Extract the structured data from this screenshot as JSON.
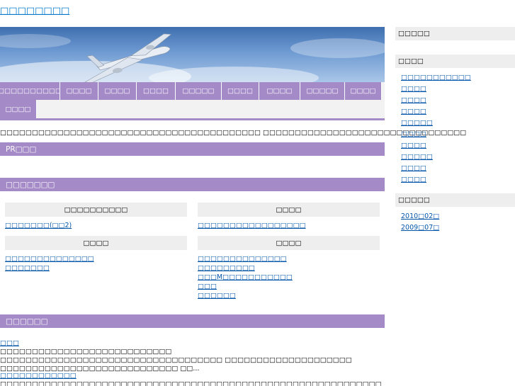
{
  "site": {
    "title": "□□□□□□□□"
  },
  "hero": {
    "image_icon": "airplane-icon"
  },
  "nav": {
    "row1": [
      "□□□□□□□□□□",
      "□□□□",
      "□□□□",
      "□□□□",
      "□□□□□",
      "□□□□",
      "□□□□",
      "□□□□□",
      "□□□□"
    ],
    "row2": [
      "□□□□"
    ]
  },
  "intro": {
    "text": "□□□□□□□□□□□□□□□□□□□□□□□□□□□□□□□□□□□□□□□□□ □□□□□□□□□□□□□□□□□□□□□□□□□□□□□□□□"
  },
  "sections": {
    "pr": "PR□□□",
    "categories": "□□□□□□□",
    "recent": "□□□□□□"
  },
  "categories": [
    {
      "title": "□□□□□□□□□□",
      "links": [
        "□□□□□□□(□□2)"
      ]
    },
    {
      "title": "□□□□",
      "links": [
        "□□□□□□□□□□□□□□□□□"
      ]
    },
    {
      "title": "□□□□",
      "links": [
        "□□□□□□□□□□□□□□",
        "□□□□□□□"
      ]
    },
    {
      "title": "□□□□",
      "links": [
        "□□□□□□□□□□□□□□",
        "□□□□□□□□□",
        "□□□M□□□□□□□□□□□",
        "□□□",
        "□□□□□□"
      ]
    }
  ],
  "articles": [
    {
      "title": "□□□",
      "body": "□□□□□□□□□□□□□□□□□□□□□□□□□□□ □□□□□□□□□□□□□□□□□□□□□□□□□□□□□□□□□□□ □□□□□□□□□□□□□□□□□□□□ □□□□□□□□□□□□□□□□□□□□□□□□□□□□ □□..."
    },
    {
      "title": "□□□□□□□□□□□□",
      "body": "□□□□□□□□□□□□□□□□□□□□□□□□□□□□□□□□□□□□□□□□□□□□□□□□□□□□□□□□□□□□ □□□□□□□□□□□□□□□□□□□□□□□□□□□□□□□□□□□□"
    }
  ],
  "sidebar": {
    "box1_title": "□□□□□",
    "box2_title": "□□□□",
    "box2_links": [
      "□□□□□□□□□□□",
      "□□□□",
      "□□□□",
      "□□□□",
      "□□□□□",
      "□□□□",
      "□□□□",
      "□□□□□",
      "□□□□",
      "□□□□"
    ],
    "archive_title": "□□□□□",
    "archive_links": [
      "2010□02□",
      "2009□07□"
    ]
  },
  "colors": {
    "accent": "#a48ac6",
    "link": "#0055aa",
    "panel": "#eeeeee"
  }
}
